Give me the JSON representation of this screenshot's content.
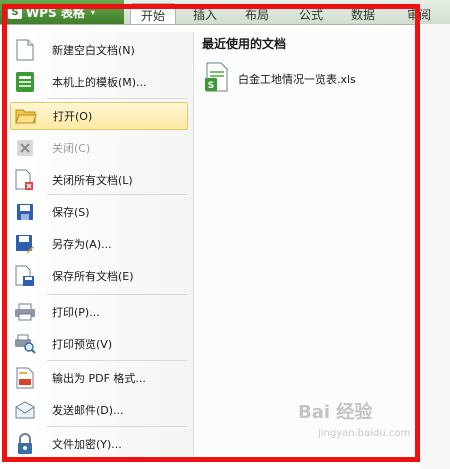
{
  "app": {
    "name": "WPS 表格",
    "logo_glyph": "S",
    "caret": "▾"
  },
  "tabs": [
    {
      "label": "开始",
      "active": true
    },
    {
      "label": "插入",
      "active": false
    },
    {
      "label": "布局",
      "active": false
    },
    {
      "label": "公式",
      "active": false
    },
    {
      "label": "数据",
      "active": false
    },
    {
      "label": "审阅",
      "active": false
    }
  ],
  "menu": [
    {
      "label": "新建空白文档(N)",
      "icon": "new-document-icon"
    },
    {
      "label": "本机上的模板(M)...",
      "icon": "template-icon"
    },
    {
      "label": "打开(O)",
      "icon": "open-folder-icon",
      "highlighted": true
    },
    {
      "label": "关闭(C)",
      "icon": "close-icon",
      "disabled": true
    },
    {
      "label": "关闭所有文档(L)",
      "icon": "close-all-icon"
    },
    {
      "label": "保存(S)",
      "icon": "save-icon"
    },
    {
      "label": "另存为(A)...",
      "icon": "save-as-icon"
    },
    {
      "label": "保存所有文档(E)",
      "icon": "save-all-icon"
    },
    {
      "label": "打印(P)...",
      "icon": "print-icon"
    },
    {
      "label": "打印预览(V)",
      "icon": "print-preview-icon"
    },
    {
      "label": "输出为 PDF 格式...",
      "icon": "pdf-export-icon"
    },
    {
      "label": "发送邮件(D)...",
      "icon": "email-icon"
    },
    {
      "label": "文件加密(Y)...",
      "icon": "lock-icon"
    }
  ],
  "recent": {
    "title": "最近使用的文档",
    "files": [
      {
        "name": "白金工地情况一览表.xls",
        "icon": "spreadsheet-file-icon"
      }
    ]
  },
  "watermark": {
    "text": "Bai 经验",
    "url": "jingyan.baidu.com"
  },
  "colors": {
    "frame": "#ee1111",
    "highlight": "#fde9a3",
    "app_green": "#3f7f2a"
  }
}
